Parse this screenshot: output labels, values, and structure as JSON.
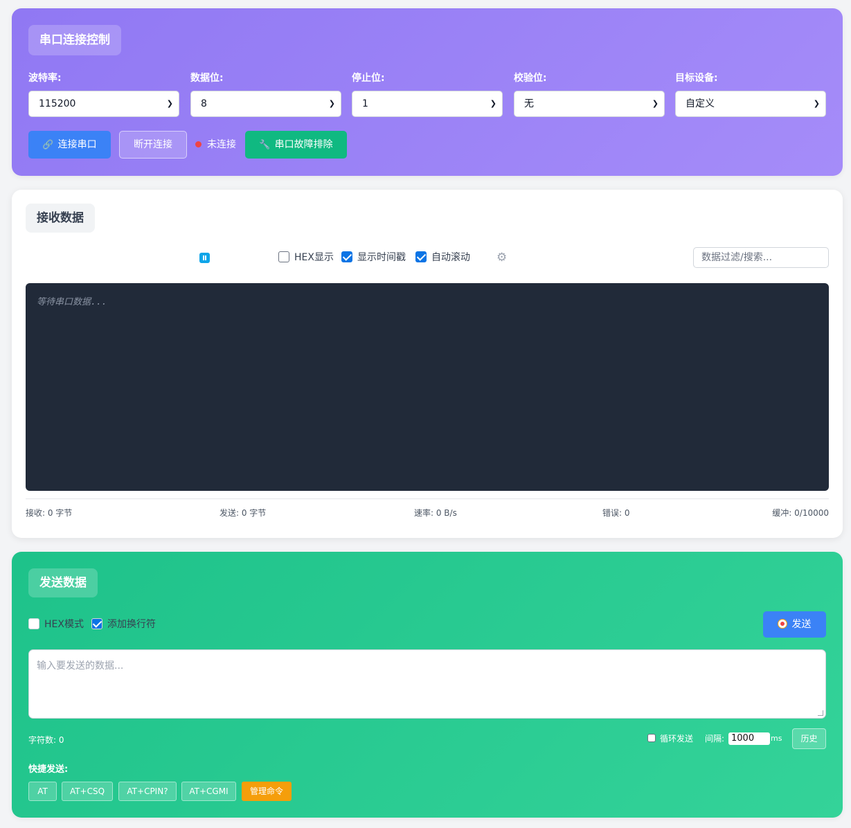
{
  "connection": {
    "title": "串口连接控制",
    "fields": [
      {
        "label": "波特率:",
        "value": "115200"
      },
      {
        "label": "数据位:",
        "value": "8"
      },
      {
        "label": "停止位:",
        "value": "1"
      },
      {
        "label": "校验位:",
        "value": "无"
      },
      {
        "label": "目标设备:",
        "value": "自定义"
      }
    ],
    "connect_label": "连接串口",
    "disconnect_label": "断开连接",
    "status_text": "未连接",
    "troubleshoot_label": "串口故障排除",
    "colors": {
      "panel": "#9078f3",
      "connect": "#3b82f6",
      "troubleshoot": "#10b981",
      "status_dot": "#ef4444"
    },
    "icons": {
      "connect": "link-icon",
      "troubleshoot": "wrench-icon"
    }
  },
  "receive": {
    "title": "接收数据",
    "options": {
      "hex_label": "HEX显示",
      "hex_checked": false,
      "timestamp_label": "显示时间戳",
      "timestamp_checked": true,
      "autoscroll_label": "自动滚动",
      "autoscroll_checked": true
    },
    "filter_placeholder": "数据过滤/搜索...",
    "terminal_placeholder": "等待串口数据...",
    "stats": {
      "received": "接收: 0 字节",
      "sent": "发送: 0 字节",
      "rate": "速率: 0 B/s",
      "errors": "错误: 0",
      "buffer": "缓冲: 0/10000"
    },
    "icons": {
      "pause": "pause-icon",
      "settings": "gear-icon"
    }
  },
  "send": {
    "title": "发送数据",
    "hex_label": "HEX模式",
    "hex_checked": false,
    "newline_label": "添加换行符",
    "newline_checked": true,
    "send_label": "发送",
    "input_placeholder": "输入要发送的数据...",
    "char_count": "字符数: 0",
    "loop_label": "循环发送",
    "loop_checked": false,
    "interval_label": "间隔:",
    "interval_value": "1000",
    "interval_unit": "ms",
    "history_label": "历史",
    "quick_label": "快捷发送:",
    "quick_commands": [
      "AT",
      "AT+CSQ",
      "AT+CPIN?",
      "AT+CGMI"
    ],
    "manage_label": "管理命令",
    "colors": {
      "panel": "#1ec28a",
      "send": "#3b82f6",
      "manage": "#f59e0b"
    }
  }
}
